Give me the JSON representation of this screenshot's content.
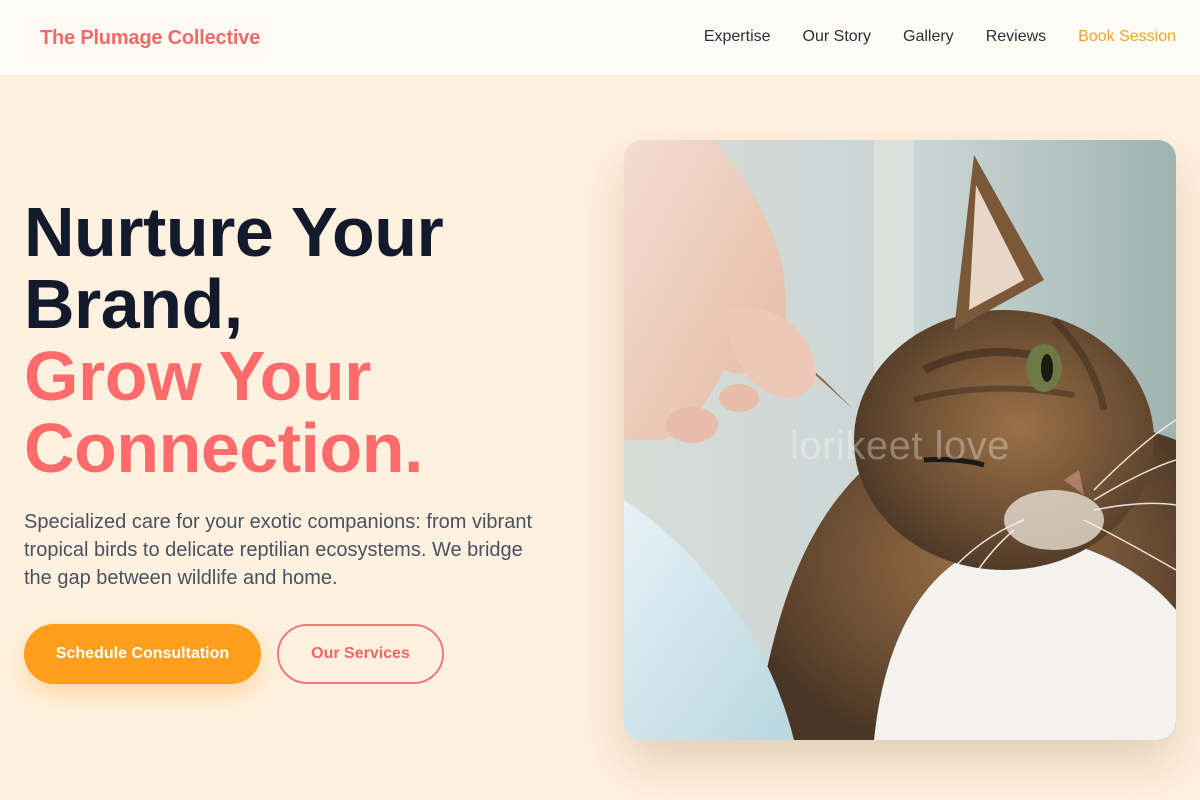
{
  "header": {
    "logo": "The Plumage Collective",
    "nav": {
      "expertise": "Expertise",
      "our_story": "Our Story",
      "gallery": "Gallery",
      "reviews": "Reviews",
      "book_session": "Book Session"
    }
  },
  "hero": {
    "headline_line1": "Nurture Your",
    "headline_line2": "Brand,",
    "headline_line3": "Grow Your",
    "headline_line4": "Connection.",
    "description": "Specialized care for your exotic companions: from vibrant tropical birds to delicate reptilian ecosystems. We bridge the gap between wildlife and home.",
    "primary_button": "Schedule Consultation",
    "secondary_button": "Our Services",
    "image_watermark": "lorikeet love"
  },
  "colors": {
    "brand": "#f06a6a",
    "accent": "#ff6b6b",
    "primary_button": "#ff9f1c",
    "book_session": "#f0a522",
    "background": "#fff1df"
  }
}
